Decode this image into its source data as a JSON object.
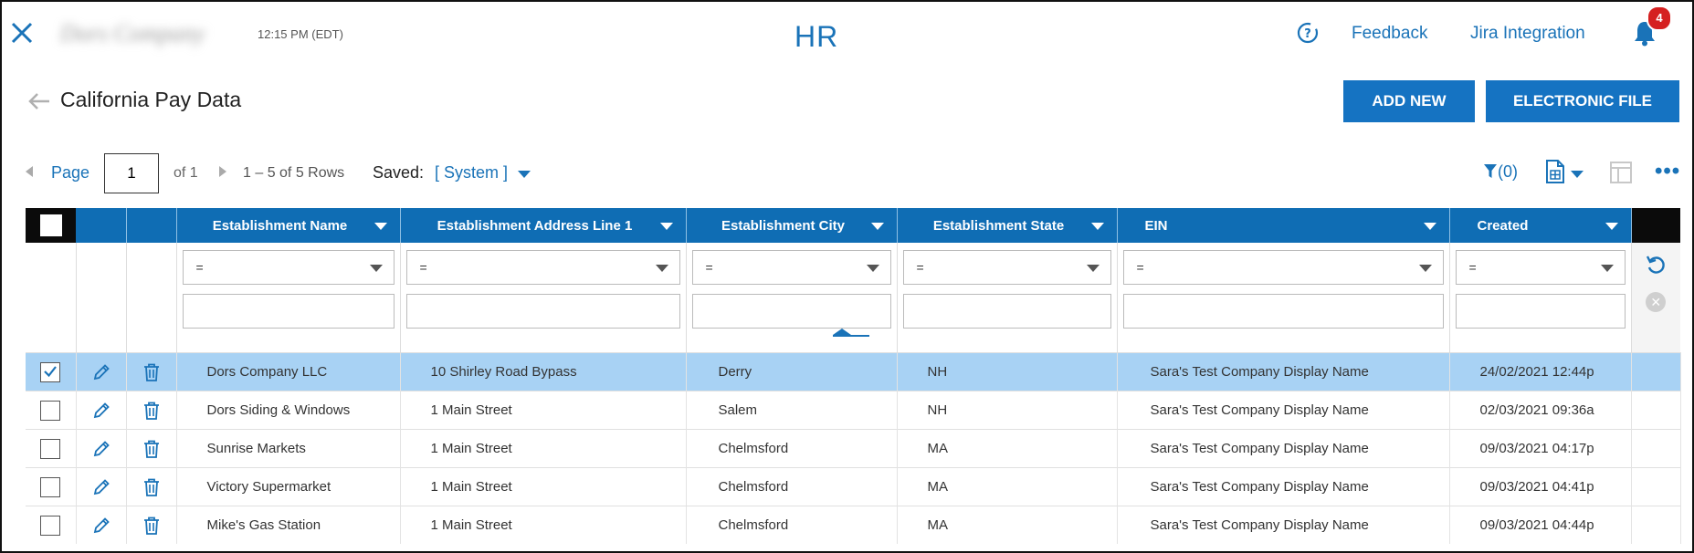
{
  "header": {
    "company_name": "Dors Company",
    "time": "12:15 PM (EDT)",
    "app_title": "HR",
    "feedback_label": "Feedback",
    "jira_label": "Jira Integration",
    "notification_count": "4"
  },
  "page": {
    "title": "California Pay Data",
    "add_new_label": "ADD NEW",
    "electronic_file_label": "ELECTRONIC FILE"
  },
  "pager": {
    "page_label": "Page",
    "page_value": "1",
    "of_label": "of 1",
    "rows_label": "1 – 5 of 5 Rows",
    "saved_label": "Saved:",
    "saved_value": "[ System ]",
    "filter_count": "(0)"
  },
  "colors": {
    "accent": "#1a73b8",
    "header_bg": "#0f6db4",
    "selected_row": "#a8d2f4"
  },
  "columns": [
    "Establishment Name",
    "Establishment Address Line 1",
    "Establishment City",
    "Establishment State",
    "EIN",
    "Created"
  ],
  "filter_operator": "=",
  "rows": [
    {
      "name": "Dors Company LLC",
      "address": "10 Shirley Road Bypass",
      "city": "Derry",
      "state": "NH",
      "ein": "Sara's Test Company Display Name",
      "created": "24/02/2021 12:44p",
      "selected": true
    },
    {
      "name": "Dors Siding & Windows",
      "address": "1 Main Street",
      "city": "Salem",
      "state": "NH",
      "ein": "Sara's Test Company Display Name",
      "created": "02/03/2021 09:36a",
      "selected": false
    },
    {
      "name": "Sunrise Markets",
      "address": "1 Main Street",
      "city": "Chelmsford",
      "state": "MA",
      "ein": "Sara's Test Company Display Name",
      "created": "09/03/2021 04:17p",
      "selected": false
    },
    {
      "name": "Victory Supermarket",
      "address": "1 Main Street",
      "city": "Chelmsford",
      "state": "MA",
      "ein": "Sara's Test Company Display Name",
      "created": "09/03/2021 04:41p",
      "selected": false
    },
    {
      "name": "Mike's Gas Station",
      "address": "1 Main Street",
      "city": "Chelmsford",
      "state": "MA",
      "ein": "Sara's Test Company Display Name",
      "created": "09/03/2021 04:44p",
      "selected": false
    }
  ]
}
